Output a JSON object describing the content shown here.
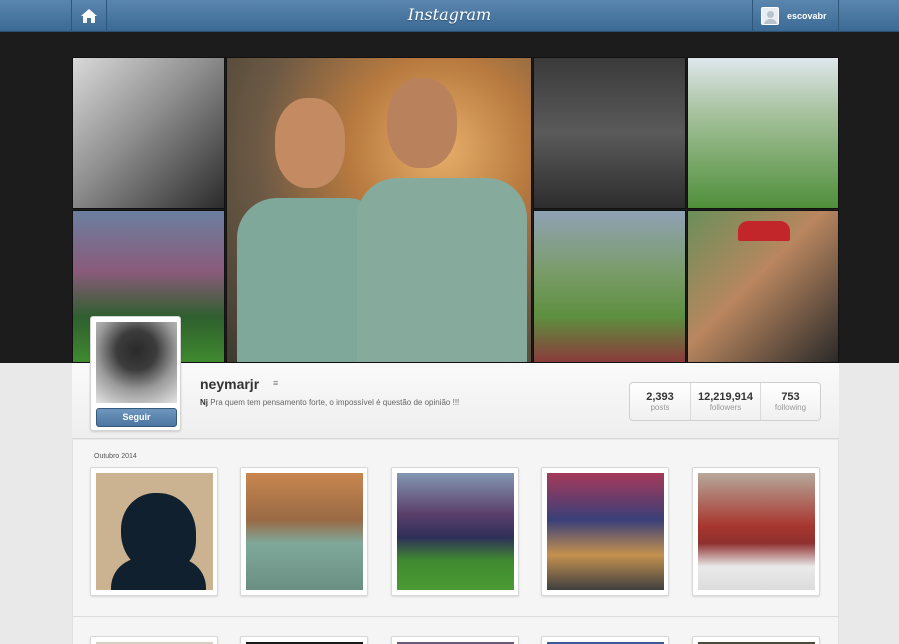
{
  "topbar": {
    "logo": "Instagram",
    "home_icon": "home-icon",
    "current_user": "escovabr"
  },
  "profile": {
    "username": "neymarjr",
    "menu_icon": "menu-lines-icon",
    "bio_prefix": "Nj",
    "bio": "Pra quem tem pensamento forte, o impossível é questão de opinião !!!",
    "follow_label": "Seguir",
    "stats": {
      "posts_count": "2,393",
      "posts_label": "posts",
      "followers_count": "12,219,914",
      "followers_label": "followers",
      "following_count": "753",
      "following_label": "following"
    }
  },
  "feed": {
    "month_label": "Outubro 2014",
    "posts_visible": 5,
    "partial_row_visible": 5
  }
}
